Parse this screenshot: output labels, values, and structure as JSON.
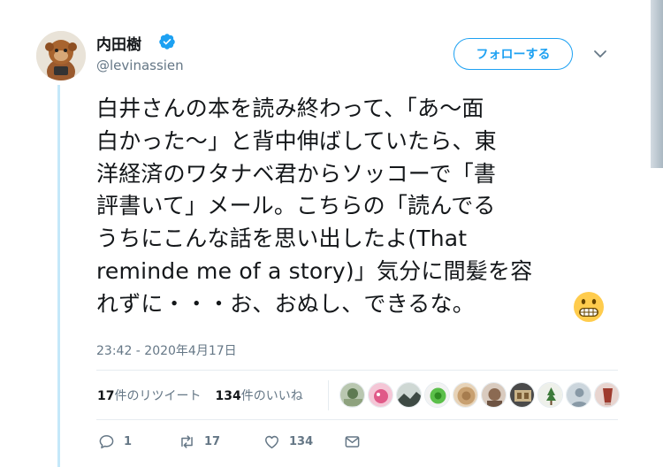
{
  "user": {
    "display_name": "内田樹",
    "handle": "@levinassien",
    "verified": true
  },
  "follow_button": {
    "label": "フォローする"
  },
  "tweet": {
    "lines": [
      "白井さんの本を読み終わって、「あ〜面",
      "白かった〜」と背中伸ばしていたら、東",
      "洋経済のワタナベ君からソッコーで「書",
      "評書いて」メール。こちらの「読んでる",
      "うちにこんな話を思い出したよ(That",
      "reminde me of a story)」気分に間髪を容",
      "れずに・・・お、おぬし、できるな。"
    ],
    "emoji": "grimacing-face",
    "timestamp": "23:42 - 2020年4月17日"
  },
  "stats": {
    "retweet_count": "17",
    "retweet_label": "件のリツイート",
    "like_count": "134",
    "like_label": "件のいいね"
  },
  "actions": {
    "reply_count": "1",
    "retweet_count": "17",
    "like_count": "134"
  },
  "colors": {
    "accent": "#1da1f2",
    "secondary_text": "#657786",
    "thread_line": "#c4e8f9"
  }
}
